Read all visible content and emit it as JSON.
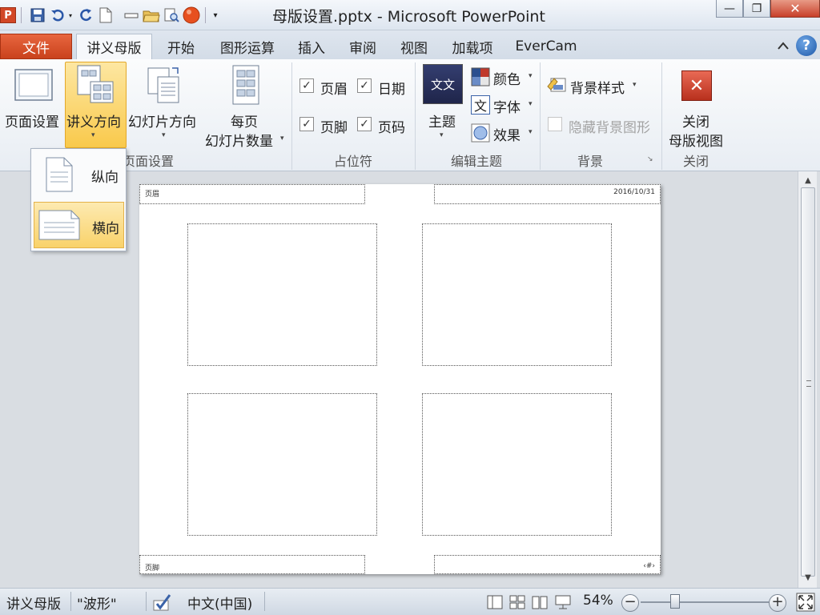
{
  "window": {
    "title": "母版设置.pptx - Microsoft PowerPoint",
    "app_icon_letter": "P",
    "controls": {
      "minimize": "—",
      "maximize": "❐",
      "close": "✕"
    }
  },
  "quick_access": [
    "save-icon",
    "undo-icon",
    "redo-icon",
    "new-icon",
    "minimize-icon",
    "open-icon",
    "print-preview-icon",
    "circle-icon",
    "customize-icon"
  ],
  "tabs": {
    "file": "文件",
    "handout_master": "讲义母版",
    "home": "开始",
    "shape_ops": "图形运算",
    "insert": "插入",
    "review": "审阅",
    "view": "视图",
    "addins": "加载项",
    "evercam": "EverCam"
  },
  "ribbon": {
    "page_setup": {
      "group_label": "页面设置",
      "page_setup_btn": "页面设置",
      "handout_orientation_btn": "讲义方向",
      "slide_orientation_btn": "幻灯片方向",
      "slides_per_page_line1": "每页",
      "slides_per_page_line2": "幻灯片数量"
    },
    "placeholders": {
      "group_label": "占位符",
      "header": "页眉",
      "date": "日期",
      "footer": "页脚",
      "page_number": "页码"
    },
    "edit_theme": {
      "group_label": "编辑主题",
      "theme_btn": "主题",
      "theme_thumb_text": "文文",
      "colors": "颜色",
      "fonts": "字体",
      "fonts_glyph": "文",
      "effects": "效果"
    },
    "background": {
      "group_label": "背景",
      "background_styles": "背景样式",
      "hide_background_graphics": "隐藏背景图形"
    },
    "close": {
      "group_label": "关闭",
      "close_line1": "关闭",
      "close_line2": "母版视图"
    }
  },
  "orientation_menu": {
    "portrait": "纵向",
    "landscape": "横向",
    "selected": "横向"
  },
  "handout_page": {
    "header_text": "页眉",
    "date_text": "2016/10/31",
    "footer_text": "页脚",
    "page_number_text": "‹#›"
  },
  "statusbar": {
    "view_name": "讲义母版",
    "theme_name": "\"波形\"",
    "language": "中文(中国)",
    "zoom": "54%",
    "zoom_minus": "−",
    "zoom_plus": "+"
  },
  "colors": {
    "file_tab": "#d24726",
    "highlight": "#f9c94b",
    "close_button": "#c8402a"
  }
}
